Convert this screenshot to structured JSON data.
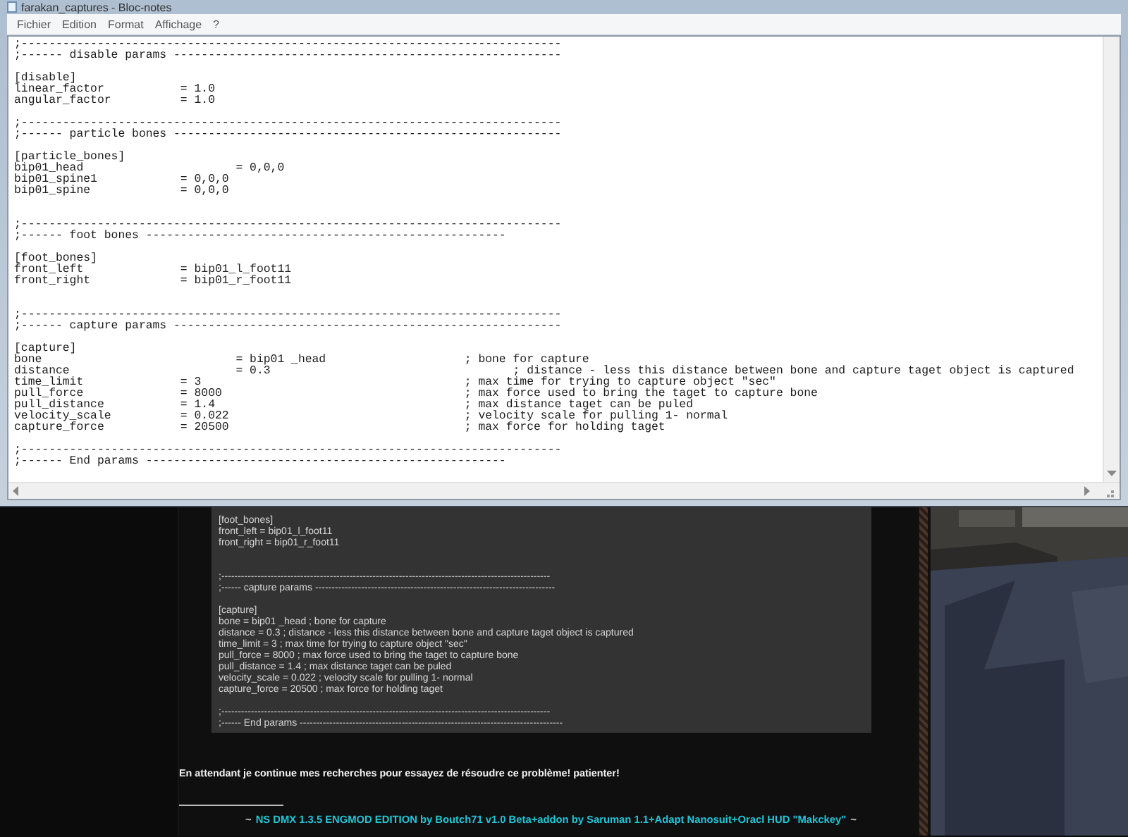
{
  "window": {
    "title": "farakan_captures - Bloc-notes"
  },
  "menu": [
    "Fichier",
    "Edition",
    "Format",
    "Affichage",
    "?"
  ],
  "editor": {
    "sections": [
      {
        "header": [
          ";------------------------------------------------------------------------------",
          ";------ disable params --------------------------------------------------------"
        ],
        "body": [
          "[disable]",
          "linear_factor           = 1.0",
          "angular_factor          = 1.0"
        ],
        "extra_gap": false
      },
      {
        "header": [
          ";------------------------------------------------------------------------------",
          ";------ particle bones --------------------------------------------------------"
        ],
        "body": [
          "[particle_bones]",
          "bip01_head                      = 0,0,0",
          "bip01_spine1            = 0,0,0",
          "bip01_spine             = 0,0,0"
        ],
        "extra_gap": true
      },
      {
        "header": [
          ";------------------------------------------------------------------------------",
          ";------ foot bones ----------------------------------------------------"
        ],
        "body": [
          "[foot_bones]",
          "front_left              = bip01_l_foot11",
          "front_right             = bip01_r_foot11"
        ],
        "extra_gap": true
      },
      {
        "header": [
          ";------------------------------------------------------------------------------",
          ";------ capture params --------------------------------------------------------"
        ],
        "body": [
          "[capture]",
          "bone                            = bip01 _head                    ; bone for capture",
          "distance                        = 0.3                                   ; distance - less this distance between bone and capture taget object is captured",
          "time_limit              = 3                                      ; max time for trying to capture object \"sec\"",
          "pull_force              = 8000                                   ; max force used to bring the taget to capture bone",
          "pull_distance           = 1.4                                    ; max distance taget can be puled",
          "velocity_scale          = 0.022                                  ; velocity scale for pulling 1- normal",
          "capture_force           = 20500                                  ; max force for holding taget"
        ],
        "extra_gap": false
      },
      {
        "header": [
          ";------------------------------------------------------------------------------",
          ";------ End params ----------------------------------------------------"
        ],
        "extra_gap": false
      }
    ]
  },
  "forum": {
    "code": {
      "sections": [
        {
          "body": [
            "[foot_bones]",
            "front_left = bip01_l_foot11",
            "front_right = bip01_r_foot11"
          ],
          "extra_gap": true
        },
        {
          "header": [
            ";----------------------------------------------------------------------------------------------------",
            ";------ capture params -------------------------------------------------------------------------"
          ],
          "body": [
            "[capture]",
            "bone = bip01 _head ; bone for capture",
            "distance = 0.3 ; distance - less this distance between bone and capture taget object is captured",
            "time_limit = 3 ; max time for trying to capture object \"sec\"",
            "pull_force = 8000 ; max force used to bring the taget to capture bone",
            "pull_distance = 1.4 ; max distance taget can be puled",
            "velocity_scale = 0.022 ; velocity scale for pulling 1- normal",
            "capture_force = 20500 ; max force for holding taget"
          ],
          "extra_gap": false
        },
        {
          "header": [
            ";----------------------------------------------------------------------------------------------------",
            ";------ End params --------------------------------------------------------------------------------"
          ],
          "extra_gap": false
        }
      ]
    },
    "message": "En attendant je continue mes recherches pour essayez de résoudre ce problème! patienter!",
    "signature": {
      "prefix": "~",
      "text": "NS DMX 1.3.5 ENGMOD EDITION by Boutch71 v1.0 Beta+addon by Saruman 1.1+Adapt Nanosuit+Oracl HUD \"Makckey\"",
      "suffix": "~"
    }
  }
}
